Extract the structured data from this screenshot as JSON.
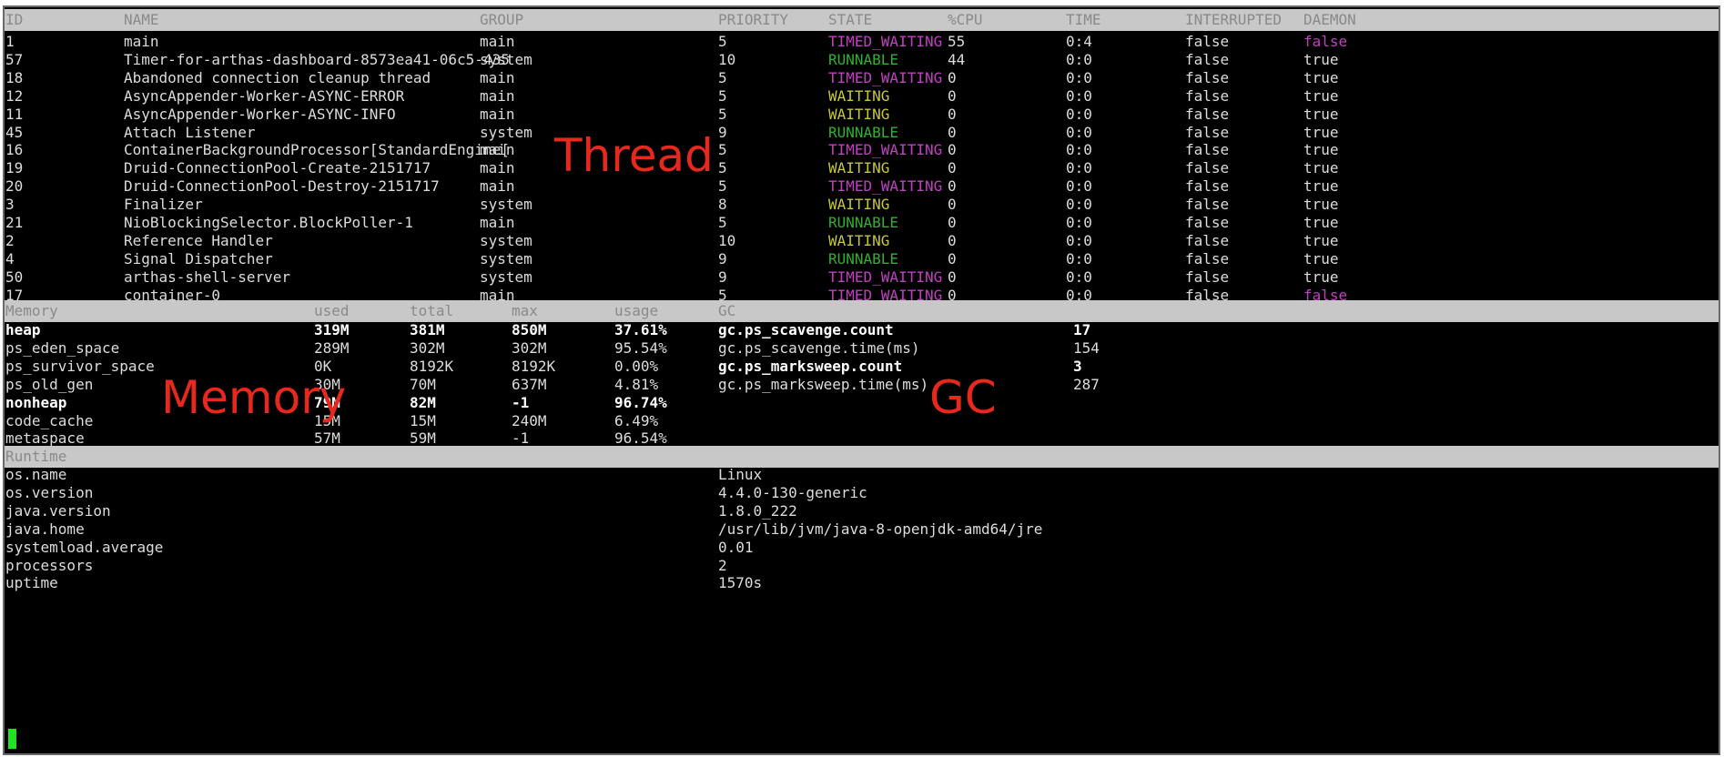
{
  "thread": {
    "headers": {
      "id": "ID",
      "name": "NAME",
      "group": "GROUP",
      "priority": "PRIORITY",
      "state": "STATE",
      "cpu": "%CPU",
      "time": "TIME",
      "interrupted": "INTERRUPTED",
      "daemon": "DAEMON"
    },
    "rows": [
      {
        "id": "1",
        "name": "main",
        "group": "main",
        "priority": "5",
        "state": "TIMED_WAITING",
        "cpu": "55",
        "time": "0:4",
        "interrupted": "false",
        "daemon": "false"
      },
      {
        "id": "57",
        "name": "Timer-for-arthas-dashboard-8573ea41-06c5-435",
        "group": "system",
        "priority": "10",
        "state": "RUNNABLE",
        "cpu": "44",
        "time": "0:0",
        "interrupted": "false",
        "daemon": "true"
      },
      {
        "id": "18",
        "name": "Abandoned connection cleanup thread",
        "group": "main",
        "priority": "5",
        "state": "TIMED_WAITING",
        "cpu": "0",
        "time": "0:0",
        "interrupted": "false",
        "daemon": "true"
      },
      {
        "id": "12",
        "name": "AsyncAppender-Worker-ASYNC-ERROR",
        "group": "main",
        "priority": "5",
        "state": "WAITING",
        "cpu": "0",
        "time": "0:0",
        "interrupted": "false",
        "daemon": "true"
      },
      {
        "id": "11",
        "name": "AsyncAppender-Worker-ASYNC-INFO",
        "group": "main",
        "priority": "5",
        "state": "WAITING",
        "cpu": "0",
        "time": "0:0",
        "interrupted": "false",
        "daemon": "true"
      },
      {
        "id": "45",
        "name": "Attach Listener",
        "group": "system",
        "priority": "9",
        "state": "RUNNABLE",
        "cpu": "0",
        "time": "0:0",
        "interrupted": "false",
        "daemon": "true"
      },
      {
        "id": "16",
        "name": "ContainerBackgroundProcessor[StandardEngine[",
        "group": "main",
        "priority": "5",
        "state": "TIMED_WAITING",
        "cpu": "0",
        "time": "0:0",
        "interrupted": "false",
        "daemon": "true"
      },
      {
        "id": "19",
        "name": "Druid-ConnectionPool-Create-2151717",
        "group": "main",
        "priority": "5",
        "state": "WAITING",
        "cpu": "0",
        "time": "0:0",
        "interrupted": "false",
        "daemon": "true"
      },
      {
        "id": "20",
        "name": "Druid-ConnectionPool-Destroy-2151717",
        "group": "main",
        "priority": "5",
        "state": "TIMED_WAITING",
        "cpu": "0",
        "time": "0:0",
        "interrupted": "false",
        "daemon": "true"
      },
      {
        "id": "3",
        "name": "Finalizer",
        "group": "system",
        "priority": "8",
        "state": "WAITING",
        "cpu": "0",
        "time": "0:0",
        "interrupted": "false",
        "daemon": "true"
      },
      {
        "id": "21",
        "name": "NioBlockingSelector.BlockPoller-1",
        "group": "main",
        "priority": "5",
        "state": "RUNNABLE",
        "cpu": "0",
        "time": "0:0",
        "interrupted": "false",
        "daemon": "true"
      },
      {
        "id": "2",
        "name": "Reference Handler",
        "group": "system",
        "priority": "10",
        "state": "WAITING",
        "cpu": "0",
        "time": "0:0",
        "interrupted": "false",
        "daemon": "true"
      },
      {
        "id": "4",
        "name": "Signal Dispatcher",
        "group": "system",
        "priority": "9",
        "state": "RUNNABLE",
        "cpu": "0",
        "time": "0:0",
        "interrupted": "false",
        "daemon": "true"
      },
      {
        "id": "50",
        "name": "arthas-shell-server",
        "group": "system",
        "priority": "9",
        "state": "TIMED_WAITING",
        "cpu": "0",
        "time": "0:0",
        "interrupted": "false",
        "daemon": "true"
      },
      {
        "id": "17",
        "name": "container-0",
        "group": "main",
        "priority": "5",
        "state": "TIMED_WAITING",
        "cpu": "0",
        "time": "0:0",
        "interrupted": "false",
        "daemon": "false"
      }
    ]
  },
  "memory": {
    "headers": {
      "memory": "Memory",
      "used": "used",
      "total": "total",
      "max": "max",
      "usage": "usage",
      "gc": "GC"
    },
    "rows": [
      {
        "name": "heap",
        "used": "319M",
        "total": "381M",
        "max": "850M",
        "usage": "37.61%",
        "bold": true
      },
      {
        "name": "ps_eden_space",
        "used": "289M",
        "total": "302M",
        "max": "302M",
        "usage": "95.54%",
        "bold": false
      },
      {
        "name": "ps_survivor_space",
        "used": "0K",
        "total": "8192K",
        "max": "8192K",
        "usage": "0.00%",
        "bold": false
      },
      {
        "name": "ps_old_gen",
        "used": "30M",
        "total": "70M",
        "max": "637M",
        "usage": "4.81%",
        "bold": false
      },
      {
        "name": "nonheap",
        "used": "79M",
        "total": "82M",
        "max": "-1",
        "usage": "96.74%",
        "bold": true
      },
      {
        "name": "code_cache",
        "used": "15M",
        "total": "15M",
        "max": "240M",
        "usage": "6.49%",
        "bold": false
      },
      {
        "name": "metaspace",
        "used": "57M",
        "total": "59M",
        "max": "-1",
        "usage": "96.54%",
        "bold": false
      }
    ]
  },
  "gc": {
    "rows": [
      {
        "name": "gc.ps_scavenge.count",
        "value": "17",
        "bold": true
      },
      {
        "name": "gc.ps_scavenge.time(ms)",
        "value": "154",
        "bold": false
      },
      {
        "name": "gc.ps_marksweep.count",
        "value": "3",
        "bold": true
      },
      {
        "name": "gc.ps_marksweep.time(ms)",
        "value": "287",
        "bold": false
      }
    ]
  },
  "runtime": {
    "header": "Runtime",
    "rows": [
      {
        "key": "os.name",
        "value": "Linux"
      },
      {
        "key": "os.version",
        "value": "4.4.0-130-generic"
      },
      {
        "key": "java.version",
        "value": "1.8.0_222"
      },
      {
        "key": "java.home",
        "value": "/usr/lib/jvm/java-8-openjdk-amd64/jre"
      },
      {
        "key": "systemload.average",
        "value": "0.01"
      },
      {
        "key": "processors",
        "value": "2"
      },
      {
        "key": "uptime",
        "value": "1570s"
      }
    ]
  },
  "annotations": {
    "thread": "Thread",
    "memory": "Memory",
    "gc": "GC"
  },
  "colors": {
    "TIMED_WAITING": "#c040c0",
    "RUNNABLE": "#30b030",
    "WAITING": "#c8c830",
    "daemon_false": "#c040c0",
    "annotation": "#e8281c",
    "cursor": "#22e022"
  }
}
